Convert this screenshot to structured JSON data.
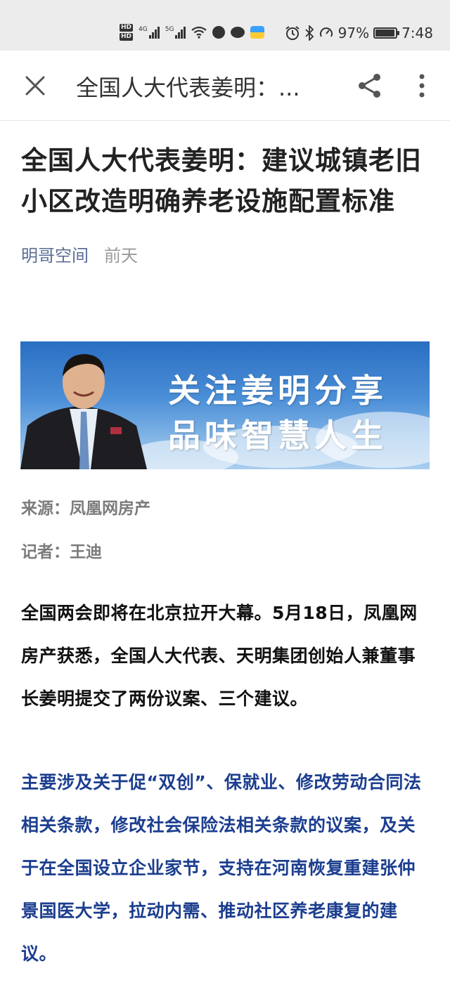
{
  "status_bar": {
    "hd1": "HD",
    "hd2": "HD",
    "net1": "4G",
    "net2": "5G",
    "battery_percent": "97%",
    "battery_level": 0.97,
    "time": "7:48"
  },
  "app_bar": {
    "title": "全国人大代表姜明：..."
  },
  "article": {
    "title": "全国人大代表姜明：建议城镇老旧小区改造明确养老设施配置标准",
    "author": "明哥空间",
    "time": "前天",
    "banner": {
      "line1": "关注姜明分享",
      "line2": "品味智慧人生"
    },
    "source": "来源：凤凰网房产",
    "reporter": "记者：王迪",
    "para1": "全国两会即将在北京拉开大幕。5月18日，凤凰网房产获悉，全国人大代表、天明集团创始人兼董事长姜明提交了两份议案、三个建议。",
    "para2": "主要涉及关于促“双创”、保就业、修改劳动合同法相关条款，修改社会保险法相关条款的议案，及关于在全国设立企业家节，支持在河南恢复重建张仲景国医大学，拉动内需、推动社区养老康复的建议。"
  },
  "colors": {
    "author": "#5a6d96",
    "highlight_text": "#1c3e8f",
    "banner_sky": "#2a6ec2"
  },
  "icons": {
    "close": "close-icon",
    "share": "share-icon",
    "more": "more-vertical-icon"
  }
}
